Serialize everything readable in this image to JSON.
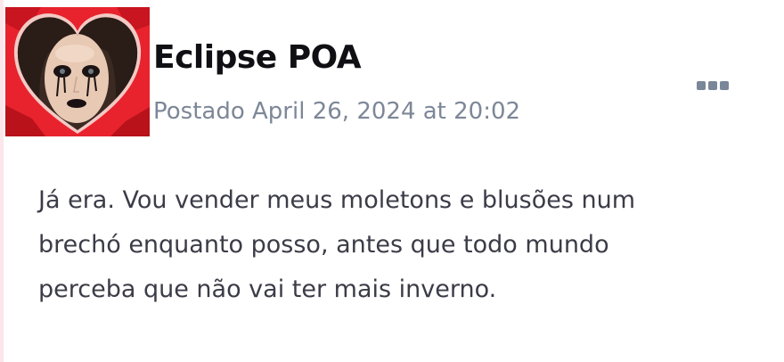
{
  "post": {
    "author": "Eclipse POA",
    "posted_label": "Postado April 26, 2024 at 20:02",
    "body_lines": [
      "Já era. Vou vender meus moletons e blusões num",
      "brechó enquanto posso, antes que todo mundo",
      "perceba que não vai ter mais inverno."
    ],
    "avatar_icon": "avatar-image",
    "more_icon": "ellipsis-icon"
  },
  "colors": {
    "author_text": "#0f0f14",
    "meta_text": "#7d8797",
    "body_text": "#3c3c48",
    "more_dots": "#7a8699",
    "avatar_red": "#e8232e",
    "left_accent": "#fbe6ec"
  }
}
